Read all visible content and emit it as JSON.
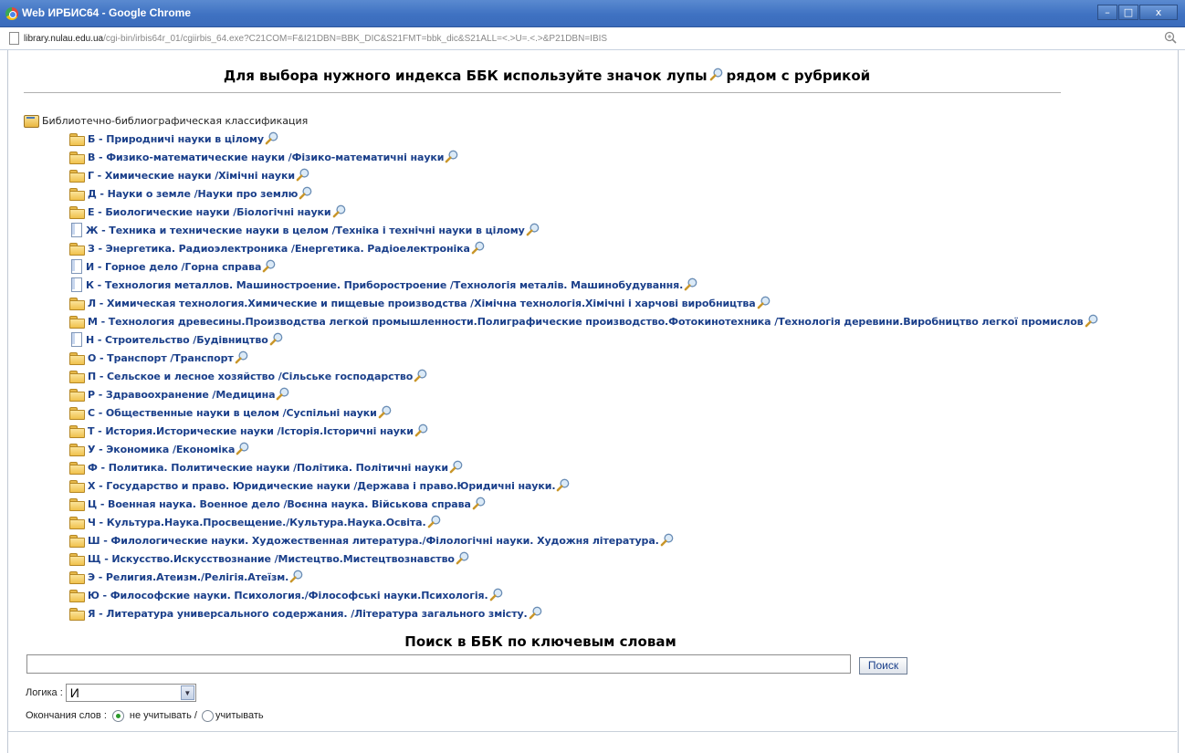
{
  "window": {
    "title": "Web ИРБИС64 - Google Chrome",
    "controls": [
      "–",
      "□",
      "x"
    ]
  },
  "address": {
    "host": "library.nulau.edu.ua",
    "path": "/cgi-bin/irbis64r_01/cgiirbis_64.exe?C21COM=F&I21DBN=BBK_DIC&S21FMT=bbk_dic&S21ALL=<.>U=.<.>&P21DBN=IBIS"
  },
  "page": {
    "heading_before": "Для выбора нужного индекса ББК используйте значок лупы",
    "heading_after": "рядом с рубрикой"
  },
  "tree": {
    "root_label": "Библиотечно-библиографическая классификация",
    "items": [
      {
        "icon": "folder",
        "label": "Б - Природничі науки в цілому"
      },
      {
        "icon": "folder",
        "label": "В - Физико-математические науки /Фізико-математичні науки"
      },
      {
        "icon": "folder",
        "label": "Г - Химические науки /Хімічні науки"
      },
      {
        "icon": "folder",
        "label": "Д - Науки о земле /Науки про землю"
      },
      {
        "icon": "folder",
        "label": "Е - Биологические науки /Біологічні науки"
      },
      {
        "icon": "document",
        "label": "Ж - Техника и технические науки в целом /Техніка і технічні науки в цілому"
      },
      {
        "icon": "folder",
        "label": "З - Энергетика. Радиоэлектроника /Енергетика. Радіоелектроніка"
      },
      {
        "icon": "document",
        "label": "И - Горное дело /Горна справа"
      },
      {
        "icon": "document",
        "label": "К - Технология металлов. Машиностроение. Приборостроение /Технологія металів. Машинобудування. "
      },
      {
        "icon": "folder",
        "label": "Л - Химическая технология.Химические и пищевые производства /Хімічна технологія.Хімічні і харчові виробництва"
      },
      {
        "icon": "folder",
        "label": "М - Технология древесины.Производства легкой промышленности.Полиграфические производство.Фотокинотехника /Технологія деревини.Виробництво легкої промислов"
      },
      {
        "icon": "document",
        "label": "Н - Строительство /Будівництво"
      },
      {
        "icon": "folder",
        "label": "О - Транспорт /Транспорт"
      },
      {
        "icon": "folder",
        "label": "П - Сельское и лесное хозяйство /Сільське господарство"
      },
      {
        "icon": "folder",
        "label": "Р - Здравоохранение /Медицина"
      },
      {
        "icon": "folder",
        "label": "С - Общественные науки в целом /Суспільні науки"
      },
      {
        "icon": "folder",
        "label": "Т - История.Исторические науки /Історія.Історичні науки"
      },
      {
        "icon": "folder",
        "label": "У - Экономика /Економіка"
      },
      {
        "icon": "folder",
        "label": "Ф - Политика. Политические науки /Політика. Політичні науки"
      },
      {
        "icon": "folder",
        "label": "Х - Государство и право. Юридические науки /Держава і право.Юридичні науки."
      },
      {
        "icon": "folder",
        "label": "Ц - Военная наука. Военное дело /Воєнна наука. Військова справа"
      },
      {
        "icon": "folder",
        "label": "Ч - Культура.Наука.Просвещение./Культура.Наука.Освіта."
      },
      {
        "icon": "folder",
        "label": "Ш - Филологические науки. Художественная литература./Філологічні науки. Художня література."
      },
      {
        "icon": "folder",
        "label": "Щ - Искусство.Искусствознание /Мистецтво.Мистецтвознавство"
      },
      {
        "icon": "folder",
        "label": "Э - Религия.Атеизм./Релігія.Атеїзм."
      },
      {
        "icon": "folder",
        "label": "Ю - Философские науки. Психология./Філософські науки.Психологія."
      },
      {
        "icon": "folder",
        "label": "Я - Литература универсального содержания. /Література загального змісту."
      }
    ]
  },
  "search": {
    "title": "Поиск в ББК по ключевым словам",
    "input_value": "",
    "button_label": "Поиск",
    "logic_label": "Логика :",
    "logic_selected": "И",
    "endings_label": "Окончания слов :",
    "endings_option_ignore": "не учитывать /",
    "endings_option_consider": "учитывать",
    "endings_selected": "ignore"
  },
  "icons": {
    "root": "book-icon",
    "folder": "folder-icon",
    "document": "document-icon",
    "select_marker": "magnifier-icon"
  },
  "colors": {
    "link": "#1a3f8a",
    "titlebar": "#3f72c2",
    "radio_checked": "#2a9a2a"
  }
}
